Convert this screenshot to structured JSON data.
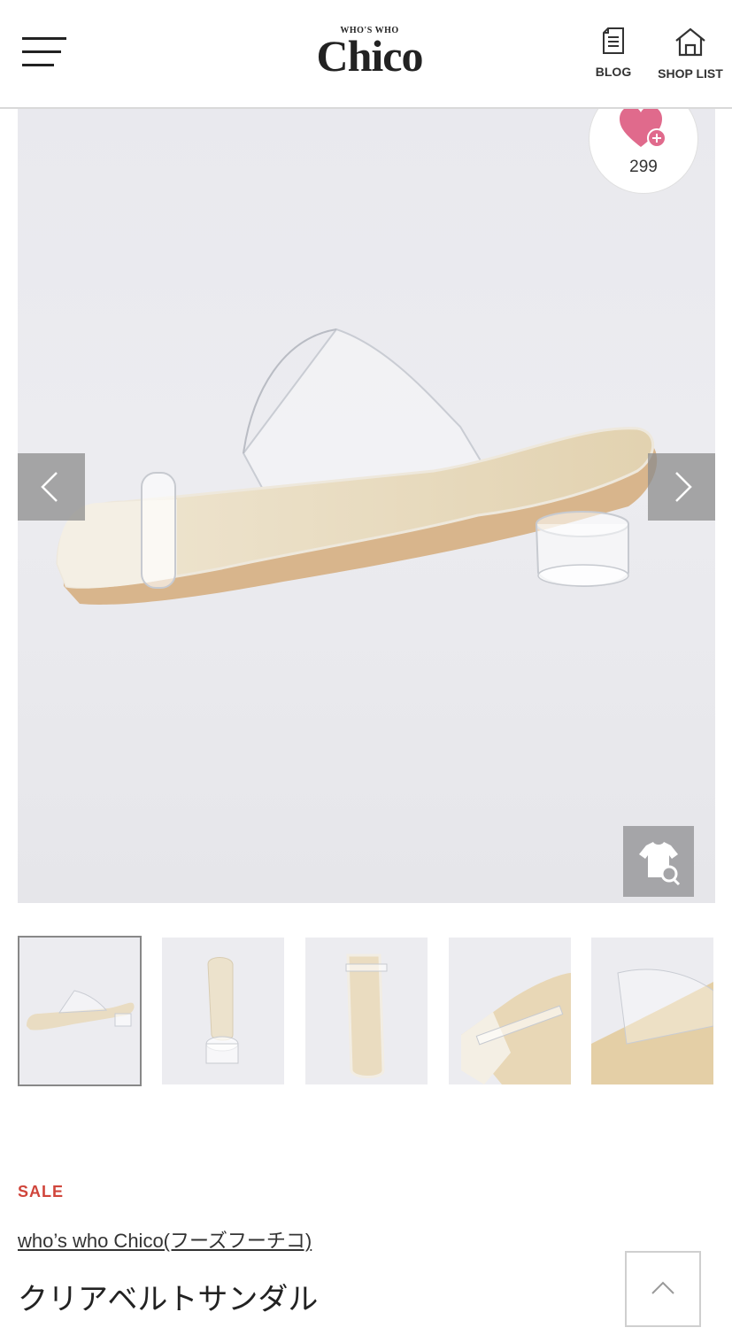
{
  "header": {
    "logo_small": "WHO'S WHO",
    "logo_big": "Chico",
    "blog_label": "BLOG",
    "shop_list_label": "SHOP LIST"
  },
  "gallery": {
    "favorite_count": "299",
    "thumbnail_count": 5,
    "active_thumbnail": 1
  },
  "product": {
    "sale_label": "SALE",
    "brand": "who’s who Chico(フーズフーチコ)",
    "name": "クリアベルトサンダル"
  },
  "colors": {
    "accent_pink": "#e06a8c",
    "sale_red": "#d0453b"
  },
  "icons": [
    "menu-icon",
    "blog-icon",
    "home-icon",
    "heart-plus-icon",
    "chevron-left-icon",
    "chevron-right-icon",
    "shirt-zoom-icon",
    "chevron-up-icon"
  ]
}
